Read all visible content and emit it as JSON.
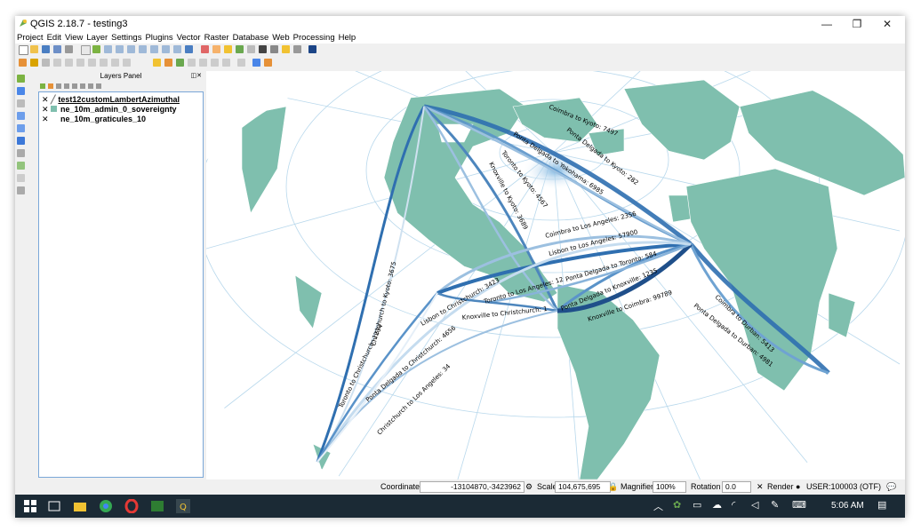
{
  "window": {
    "title": "QGIS 2.18.7 - testing3",
    "minimize": "—",
    "maximize": "❐",
    "close": "✕"
  },
  "menu": [
    "Project",
    "Edit",
    "View",
    "Layer",
    "Settings",
    "Plugins",
    "Vector",
    "Raster",
    "Database",
    "Web",
    "Processing",
    "Help"
  ],
  "layers_panel": {
    "title": "Layers Panel",
    "layers": [
      {
        "name": "test12customLambertAzimuthal",
        "checked": true
      },
      {
        "name": "ne_10m_admin_0_sovereignty",
        "checked": true
      },
      {
        "name": "ne_10m_graticules_10",
        "checked": true
      }
    ]
  },
  "flow_labels": [
    "Coimbra to Kyoto: 7497",
    "Ponta Delgada to Kyoto: 282",
    "Ponta Delgada to Yokohama: 6985",
    "Toronto to Kyoto: 4567",
    "Knoxville to Kyoto: 3689",
    "Coimbra to Los Angeles: 2356",
    "Lisbon to Los Angeles: 57900",
    "Ponta Delgada to Toronto: 584",
    "Ponta Delgada to Knoxville: 1235",
    "Knoxville to Coimbra: 99789",
    "Coimbra to Durban: 5413",
    "Ponta Delgada to Durban: 4981",
    "Lisbon to Christchurch: 3423",
    "Toronto to Los Angeles: 12",
    "Knoxville to Christchurch: 1",
    "Christchurch to Kyoto: 3675",
    "Toronto to Christchurch: 1234",
    "Ponta Delgada to Christchurch: 4656",
    "Christchurch to Los Angeles: 34"
  ],
  "status": {
    "coordinate_label": "Coordinate",
    "coordinate_value": "-13104870,-3423962",
    "scale_label": "Scale",
    "scale_value": "104,675,695",
    "magnifier_label": "Magnifier",
    "magnifier_value": "100%",
    "rotation_label": "Rotation",
    "rotation_value": "0.0",
    "render_label": "Render",
    "crs": "USER:100003 (OTF)"
  },
  "taskbar": {
    "time": "5:06 AM"
  },
  "colors": {
    "land": "#7fbfae",
    "ocean": "#ffffff",
    "graticule": "#b8d8ec",
    "flow_dark": "#2f6fb0",
    "flow_light": "#c5dcef"
  }
}
